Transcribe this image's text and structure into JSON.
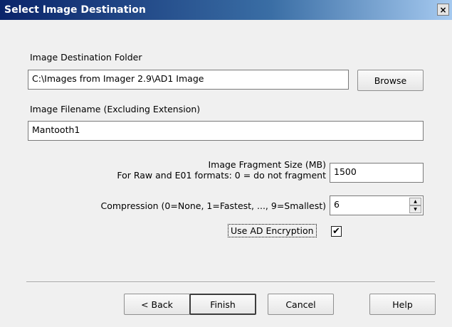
{
  "window": {
    "title": "Select Image Destination",
    "close_glyph": "×",
    "close_icon": "close-icon"
  },
  "destination": {
    "label": "Image Destination Folder",
    "value": "C:\\Images from Imager 2.9\\AD1 Image",
    "browse_label": "Browse"
  },
  "filename": {
    "label": "Image Filename (Excluding Extension)",
    "value": "Mantooth1"
  },
  "fragment": {
    "label_line1": "Image Fragment Size (MB)",
    "label_line2": "For Raw and E01 formats: 0 = do not fragment",
    "value": "1500"
  },
  "compression": {
    "label": "Compression (0=None, 1=Fastest, ..., 9=Smallest)",
    "value": "6",
    "up_glyph": "▲",
    "down_glyph": "▼"
  },
  "encryption": {
    "label": "Use AD Encryption",
    "checked": true,
    "check_glyph": "✔"
  },
  "buttons": {
    "back": "< Back",
    "finish": "Finish",
    "cancel": "Cancel",
    "help": "Help"
  }
}
